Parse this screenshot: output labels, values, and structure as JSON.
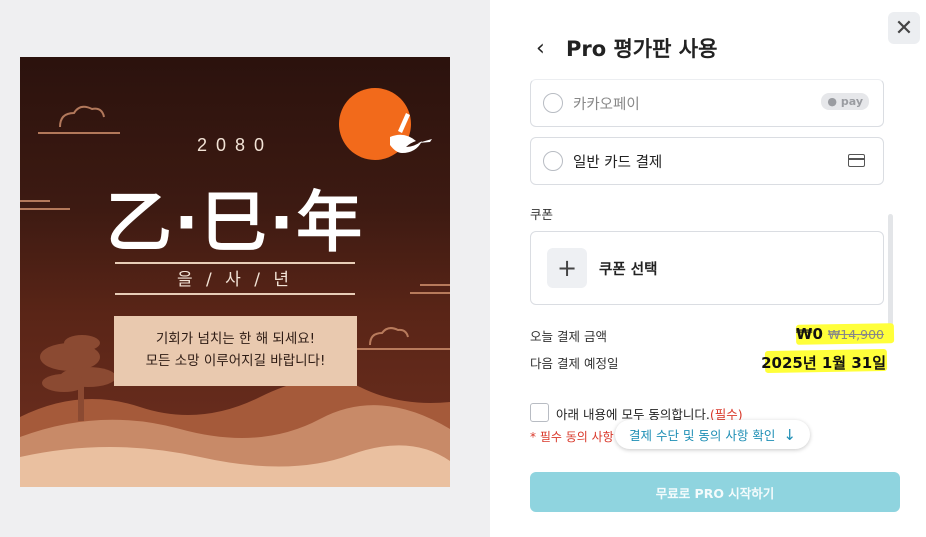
{
  "poster": {
    "year": "2080",
    "title": "乙·巳·年",
    "subtitle": "을 / 사 / 년",
    "message_line1": "기회가 넘치는 한 해 되세요!",
    "message_line2": "모든 소망 이루어지길 바랍니다!"
  },
  "header": {
    "back_icon": "chevron-left-icon",
    "title": "Pro 평가판 사용",
    "close_icon": "close-icon"
  },
  "payment_methods": [
    {
      "label": "카카오페이",
      "badge": "pay",
      "selected": false
    },
    {
      "label": "일반 카드 결제",
      "icon": "credit-card-icon",
      "selected": false
    }
  ],
  "coupon": {
    "heading": "쿠폰",
    "button_label": "쿠폰 선택",
    "icon": "plus-icon"
  },
  "summary": {
    "today_label": "오늘 결제 금액",
    "today_amount": "₩0",
    "original_amount": "₩14,900",
    "next_label": "다음 결제 예정일",
    "next_date": "2025년 1월 31일"
  },
  "agreement": {
    "checkbox_label": "아래 내용에 모두 동의합니다.",
    "required_tag": "(필수)",
    "required_note": "* 필수 동의 사항",
    "confirm_chip": "결제 수단 및 동의 사항 확인",
    "confirm_icon": "arrow-down-icon",
    "checked": false
  },
  "cta": {
    "label": "무료로 PRO 시작하기"
  },
  "colors": {
    "accent": "#8fd4df",
    "highlight": "#ffff3a",
    "required": "#d9382a",
    "link": "#1f8fb5"
  }
}
